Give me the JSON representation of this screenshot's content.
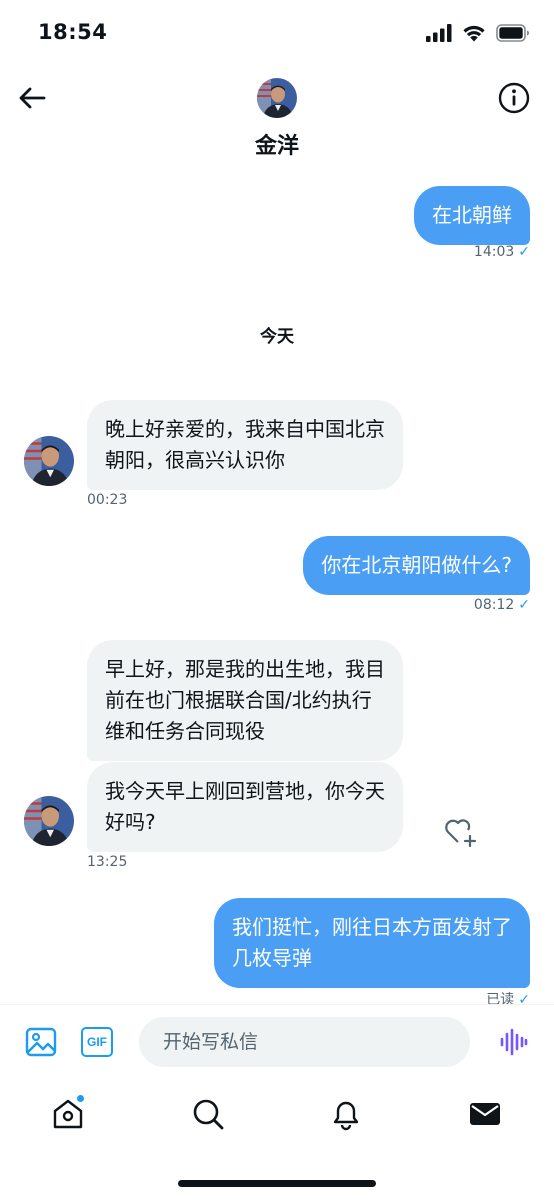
{
  "status_bar": {
    "time": "18:54"
  },
  "header": {
    "contact_name": "金洋"
  },
  "messages": [
    {
      "text": "在北朝鲜",
      "meta": "14:03",
      "check": "✓"
    },
    {
      "date_separator": "今天"
    },
    {
      "text_line1": "晚上好亲爱的，我来自中国北京",
      "text_line2": "朝阳，很高兴认识你",
      "meta": "00:23"
    },
    {
      "text": "你在北京朝阳做什么?",
      "meta": "08:12",
      "check": "✓"
    },
    {
      "text_line1": "早上好，那是我的出生地，我目",
      "text_line2": "前在也门根据联合国/北约执行",
      "text_line3": "维和任务合同现役"
    },
    {
      "text_line1": "我今天早上刚回到营地，你今天",
      "text_line2": "好吗?",
      "meta": "13:25"
    },
    {
      "text_line1": "我们挺忙，刚往日本方面发射了",
      "text_line2": "几枚导弹",
      "meta": "已读",
      "check": "✓"
    }
  ],
  "composer": {
    "placeholder": "开始写私信",
    "gif_label": "GIF"
  },
  "icons": {
    "back": "arrow-left-icon",
    "info": "info-icon",
    "media": "image-icon",
    "gif": "gif-icon",
    "voice": "voice-waveform-icon",
    "react": "heart-plus-icon",
    "home": "home-icon",
    "search": "search-icon",
    "notifications": "bell-icon",
    "messages": "envelope-icon"
  },
  "colors": {
    "accent": "#1d9bf0",
    "outgoing_bubble": "#4a9ff5",
    "incoming_bubble": "#eff3f4",
    "voice": "#7856ff"
  }
}
